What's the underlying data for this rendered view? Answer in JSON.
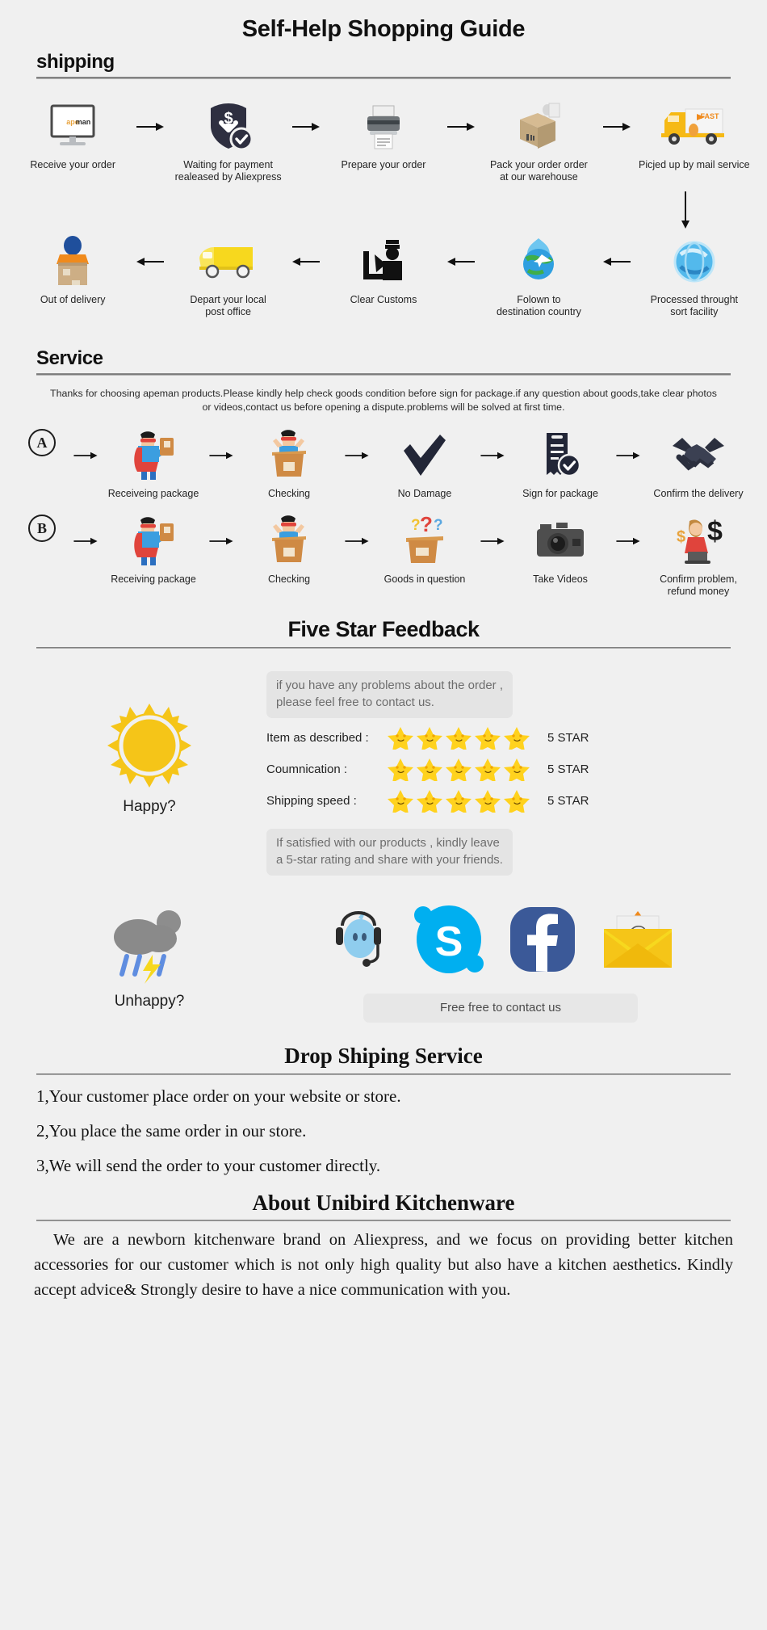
{
  "title": "Self-Help Shopping Guide",
  "shipping": {
    "heading": "shipping",
    "row1": [
      {
        "caption": "Receive your order",
        "icon": "monitor-apeman-icon",
        "logo": "apeman"
      },
      {
        "caption": "Waiting for payment\nrealeased by Aliexpress",
        "icon": "payment-shield-dollar-icon"
      },
      {
        "caption": "Prepare your order",
        "icon": "printer-icon"
      },
      {
        "caption": "Pack your order order\nat our warehouse",
        "icon": "packing-box-worker-icon"
      },
      {
        "caption": "Picjed up by mail service",
        "icon": "fast-delivery-truck-icon",
        "badge": "FAST"
      }
    ],
    "row2": [
      {
        "caption": "Out of delivery",
        "icon": "courier-carrying-box-icon"
      },
      {
        "caption": "Depart your local\npost office",
        "icon": "yellow-van-icon"
      },
      {
        "caption": "Clear Customs",
        "icon": "customs-officer-icon"
      },
      {
        "caption": "Folown to\ndestination country",
        "icon": "globe-airplane-icon"
      },
      {
        "caption": "Processed throught\nsort facility",
        "icon": "blue-sphere-sorting-icon"
      }
    ]
  },
  "service": {
    "heading": "Service",
    "note": "Thanks for choosing apeman products.Please kindly help check goods condition before sign for package.if any question about goods,take clear photos or videos,contact us before opening a dispute.problems will be solved at first time.",
    "rowA": {
      "badge": "A",
      "steps": [
        {
          "caption": "Receiveing package",
          "icon": "hero-holding-package-icon"
        },
        {
          "caption": "Checking",
          "icon": "hero-in-open-box-icon"
        },
        {
          "caption": "No Damage",
          "icon": "checkmark-icon"
        },
        {
          "caption": "Sign for package",
          "icon": "signed-document-icon"
        },
        {
          "caption": "Confirm the delivery",
          "icon": "handshake-icon"
        }
      ]
    },
    "rowB": {
      "badge": "B",
      "steps": [
        {
          "caption": "Receiving package",
          "icon": "hero-holding-package-icon"
        },
        {
          "caption": "Checking",
          "icon": "hero-in-open-box-icon"
        },
        {
          "caption": "Goods in question",
          "icon": "question-marks-box-icon"
        },
        {
          "caption": "Take Videos",
          "icon": "camera-icon"
        },
        {
          "caption": "Confirm problem,\nrefund money",
          "icon": "refund-agent-dollar-icon"
        }
      ]
    }
  },
  "feedback": {
    "heading": "Five Star Feedback",
    "bubble_top": "if you have any problems about the order ,\nplease feel free to contact us.",
    "ratings": [
      {
        "label": "Item as described :",
        "stars": 5,
        "value": "5 STAR"
      },
      {
        "label": "Coumnication :",
        "stars": 5,
        "value": "5 STAR"
      },
      {
        "label": "Shipping speed :",
        "stars": 5,
        "value": "5 STAR"
      }
    ],
    "bubble_bottom": "If satisfied with our products ,  kindly leave\na 5-star rating and share with your friends.",
    "happy_label": "Happy?",
    "unhappy_label": "Unhappy?",
    "contact_bar": "Free free to contact us",
    "social": [
      {
        "name": "trademanager-icon"
      },
      {
        "name": "skype-icon",
        "letter": "S"
      },
      {
        "name": "facebook-icon",
        "letter": "f"
      },
      {
        "name": "email-icon",
        "letter": "@"
      }
    ],
    "colors": {
      "star": "#ffd21e",
      "sun": "#f5c518",
      "skype": "#00aff0",
      "facebook": "#3b5998"
    }
  },
  "dropshipping": {
    "heading": "Drop Shiping Service",
    "items": [
      "1,Your customer place order on your website or store.",
      "2,You place the same order in our store.",
      "3,We will send the order to your customer directly."
    ]
  },
  "about": {
    "heading": "About Unibird Kitchenware",
    "body": "We are a newborn kitchenware brand on Aliexpress, and we focus on providing better kitchen accessories for our customer which is not only high quality but also have a kitchen aesthetics. Kindly accept advice& Strongly desire to have a nice communication with you."
  }
}
